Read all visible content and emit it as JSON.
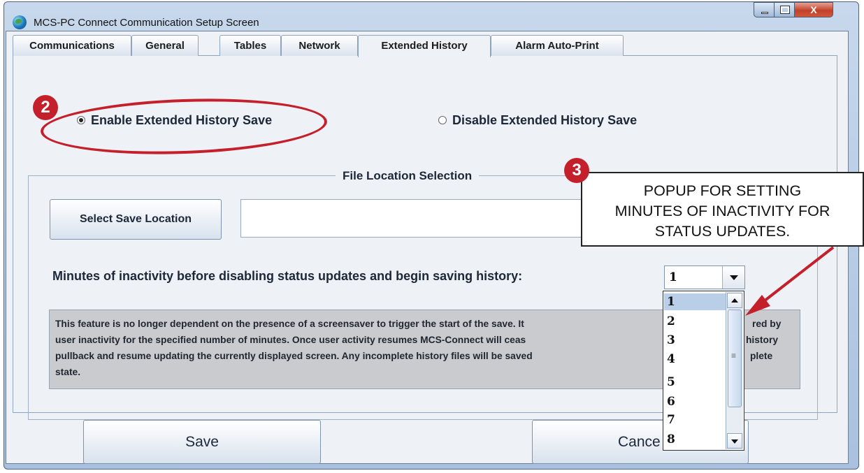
{
  "window": {
    "title": "MCS-PC Connect Communication Setup Screen",
    "close_glyph": "X"
  },
  "tabs": [
    {
      "label": "Communications"
    },
    {
      "label": "General"
    },
    {
      "label": "Tables"
    },
    {
      "label": "Network"
    },
    {
      "label": "Extended History",
      "active": true
    },
    {
      "label": "Alarm Auto-Print"
    }
  ],
  "history_mode": {
    "enable_label": "Enable Extended History Save",
    "disable_label": "Disable Extended History Save",
    "selected": "enable"
  },
  "file_location": {
    "group_title": "File Location Selection",
    "select_button": "Select Save Location",
    "path_value": ""
  },
  "minutes": {
    "label": "Minutes of inactivity before disabling status updates and begin saving history:",
    "selected_value": "1",
    "options": [
      "1",
      "2",
      "3",
      "4",
      "5",
      "6",
      "7",
      "8"
    ]
  },
  "info_text": {
    "line1": "This feature is no longer dependent on the presence of a screensaver to trigger the start of the save. It",
    "line1_tail": "red by",
    "line2": "user inactivity for the specified number of minutes. Once user activity resumes MCS-Connect will ceas",
    "line2_tail": "history",
    "line3": "pullback and resume updating the currently displayed screen. Any incomplete history files will be saved",
    "line3_tail": "plete",
    "line4": "state."
  },
  "buttons": {
    "save": "Save",
    "cancel": "Cance"
  },
  "annotations": {
    "badge_2": "2",
    "badge_3": "3",
    "callout_line1": "POPUP FOR SETTING",
    "callout_line2": "MINUTES OF INACTIVITY FOR",
    "callout_line3": "STATUS UPDATES.",
    "color": "#c4202b"
  }
}
